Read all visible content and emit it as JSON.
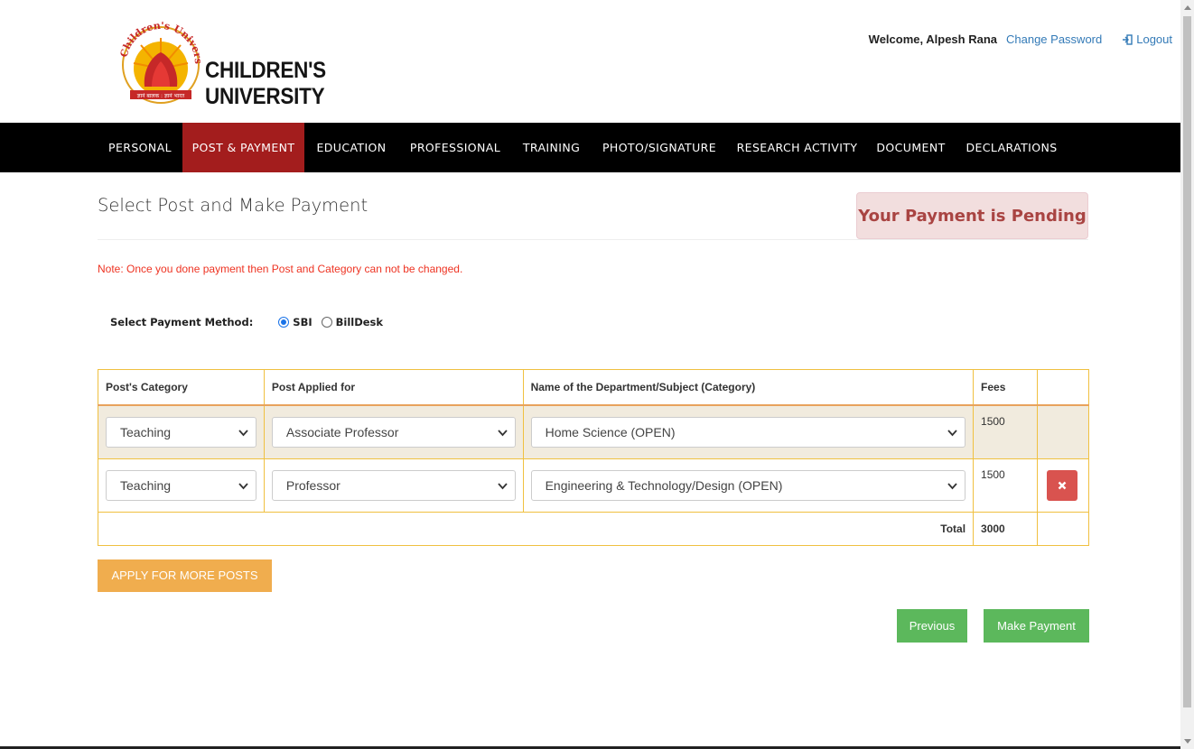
{
  "header": {
    "logo_arc_text": "Children's University",
    "logo_subtext": "ज्ञानं बालक : ज्ञानं भारत",
    "logo_title": "CHILDREN'S UNIVERSITY",
    "welcome": "Welcome, Alpesh Rana",
    "change_password": "Change Password",
    "logout": "Logout"
  },
  "nav": {
    "items": [
      {
        "label": "PERSONAL"
      },
      {
        "label": "POST & PAYMENT"
      },
      {
        "label": "EDUCATION"
      },
      {
        "label": "PROFESSIONAL"
      },
      {
        "label": "TRAINING"
      },
      {
        "label": "PHOTO/SIGNATURE"
      },
      {
        "label": "RESEARCH ACTIVITY"
      },
      {
        "label": "DOCUMENT"
      },
      {
        "label": "DECLARATIONS"
      }
    ],
    "active": "POST & PAYMENT"
  },
  "page": {
    "title": "Select Post and Make Payment",
    "alert": "Your Payment is Pending",
    "note": "Note: Once you done payment then Post and Category can not be changed."
  },
  "payment_method": {
    "label": "Select Payment Method:",
    "options": [
      "SBI",
      "BillDesk"
    ],
    "selected": "SBI"
  },
  "table": {
    "headers": [
      "Post's Category",
      "Post Applied for",
      "Name of the Department/Subject (Category)",
      "Fees",
      ""
    ],
    "rows": [
      {
        "category": "Teaching",
        "post": "Associate Professor",
        "department": "Home Science (OPEN)",
        "fees": "1500"
      },
      {
        "category": "Teaching",
        "post": "Professor",
        "department": "Engineering & Technology/Design (OPEN)",
        "fees": "1500"
      }
    ],
    "total_label": "Total",
    "total_value": "3000"
  },
  "buttons": {
    "apply_more": "APPLY FOR MORE POSTS",
    "previous": "Previous",
    "make_payment": "Make Payment"
  },
  "colors": {
    "nav_bg": "#000000",
    "nav_active": "#a31d1d",
    "alert_bg": "#f2dede",
    "alert_text": "#a94442",
    "note_text": "#ee3322",
    "apply_btn": "#f0ad4e",
    "green_btn": "#5cb85c",
    "delete_btn": "#d9534f"
  }
}
